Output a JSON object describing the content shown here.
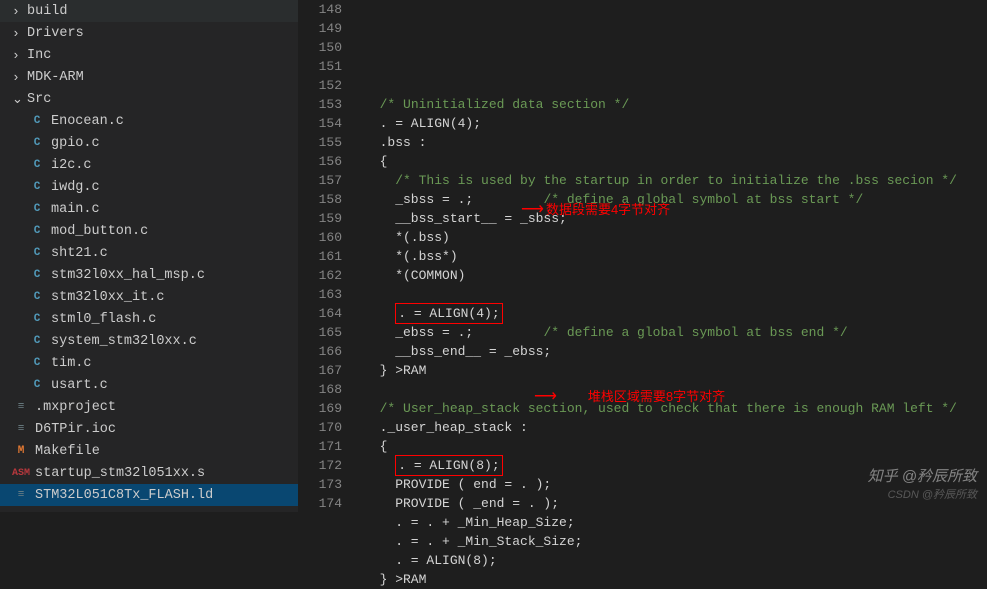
{
  "sidebar": {
    "items": [
      {
        "icon": ">",
        "label": "build",
        "type": "folder",
        "level": 1
      },
      {
        "icon": ">",
        "label": "Drivers",
        "type": "folder",
        "level": 1
      },
      {
        "icon": ">",
        "label": "Inc",
        "type": "folder",
        "level": 1
      },
      {
        "icon": ">",
        "label": "MDK-ARM",
        "type": "folder",
        "level": 1
      },
      {
        "icon": "v",
        "label": "Src",
        "type": "folder",
        "level": 1
      },
      {
        "icon": "C",
        "label": "Enocean.c",
        "type": "c",
        "level": 2
      },
      {
        "icon": "C",
        "label": "gpio.c",
        "type": "c",
        "level": 2
      },
      {
        "icon": "C",
        "label": "i2c.c",
        "type": "c",
        "level": 2
      },
      {
        "icon": "C",
        "label": "iwdg.c",
        "type": "c",
        "level": 2
      },
      {
        "icon": "C",
        "label": "main.c",
        "type": "c",
        "level": 2
      },
      {
        "icon": "C",
        "label": "mod_button.c",
        "type": "c",
        "level": 2
      },
      {
        "icon": "C",
        "label": "sht21.c",
        "type": "c",
        "level": 2
      },
      {
        "icon": "C",
        "label": "stm32l0xx_hal_msp.c",
        "type": "c",
        "level": 2
      },
      {
        "icon": "C",
        "label": "stm32l0xx_it.c",
        "type": "c",
        "level": 2
      },
      {
        "icon": "C",
        "label": "stml0_flash.c",
        "type": "c",
        "level": 2
      },
      {
        "icon": "C",
        "label": "system_stm32l0xx.c",
        "type": "c",
        "level": 2
      },
      {
        "icon": "C",
        "label": "tim.c",
        "type": "c",
        "level": 2
      },
      {
        "icon": "C",
        "label": "usart.c",
        "type": "c",
        "level": 2
      },
      {
        "icon": "≡",
        "label": ".mxproject",
        "type": "cfg",
        "level": 1
      },
      {
        "icon": "≡",
        "label": "D6TPir.ioc",
        "type": "cfg",
        "level": 1
      },
      {
        "icon": "M",
        "label": "Makefile",
        "type": "make",
        "level": 1
      },
      {
        "icon": "ASM",
        "label": "startup_stm32l051xx.s",
        "type": "asm",
        "level": 1
      },
      {
        "icon": "≡",
        "label": "STM32L051C8Tx_FLASH.ld",
        "type": "ld",
        "level": 1,
        "active": true
      }
    ]
  },
  "editor": {
    "startLine": 148,
    "lines": [
      "",
      "  /* Uninitialized data section */",
      "  . = ALIGN(4);",
      "  .bss :",
      "  {",
      "    /* This is used by the startup in order to initialize the .bss secion */",
      "    _sbss = .;         /* define a global symbol at bss start */",
      "    __bss_start__ = _sbss;",
      "    *(.bss)",
      "    *(.bss*)",
      "    *(COMMON)",
      "",
      "    . = ALIGN(4);",
      "    _ebss = .;         /* define a global symbol at bss end */",
      "    __bss_end__ = _ebss;",
      "  } >RAM",
      "",
      "  /* User_heap_stack section, used to check that there is enough RAM left */",
      "  ._user_heap_stack :",
      "  {",
      "    . = ALIGN(8);",
      "    PROVIDE ( end = . );",
      "    PROVIDE ( _end = . );",
      "    . = . + _Min_Heap_Size;",
      "    . = . + _Min_Stack_Size;",
      "    . = ALIGN(8);",
      "  } >RAM"
    ]
  },
  "annotations": {
    "note1": "数据段需要4字节对齐",
    "note2": "堆栈区域需要8字节对齐"
  },
  "watermark": {
    "main": "知乎 @矜辰所致",
    "sub": "CSDN @矜辰所致"
  }
}
